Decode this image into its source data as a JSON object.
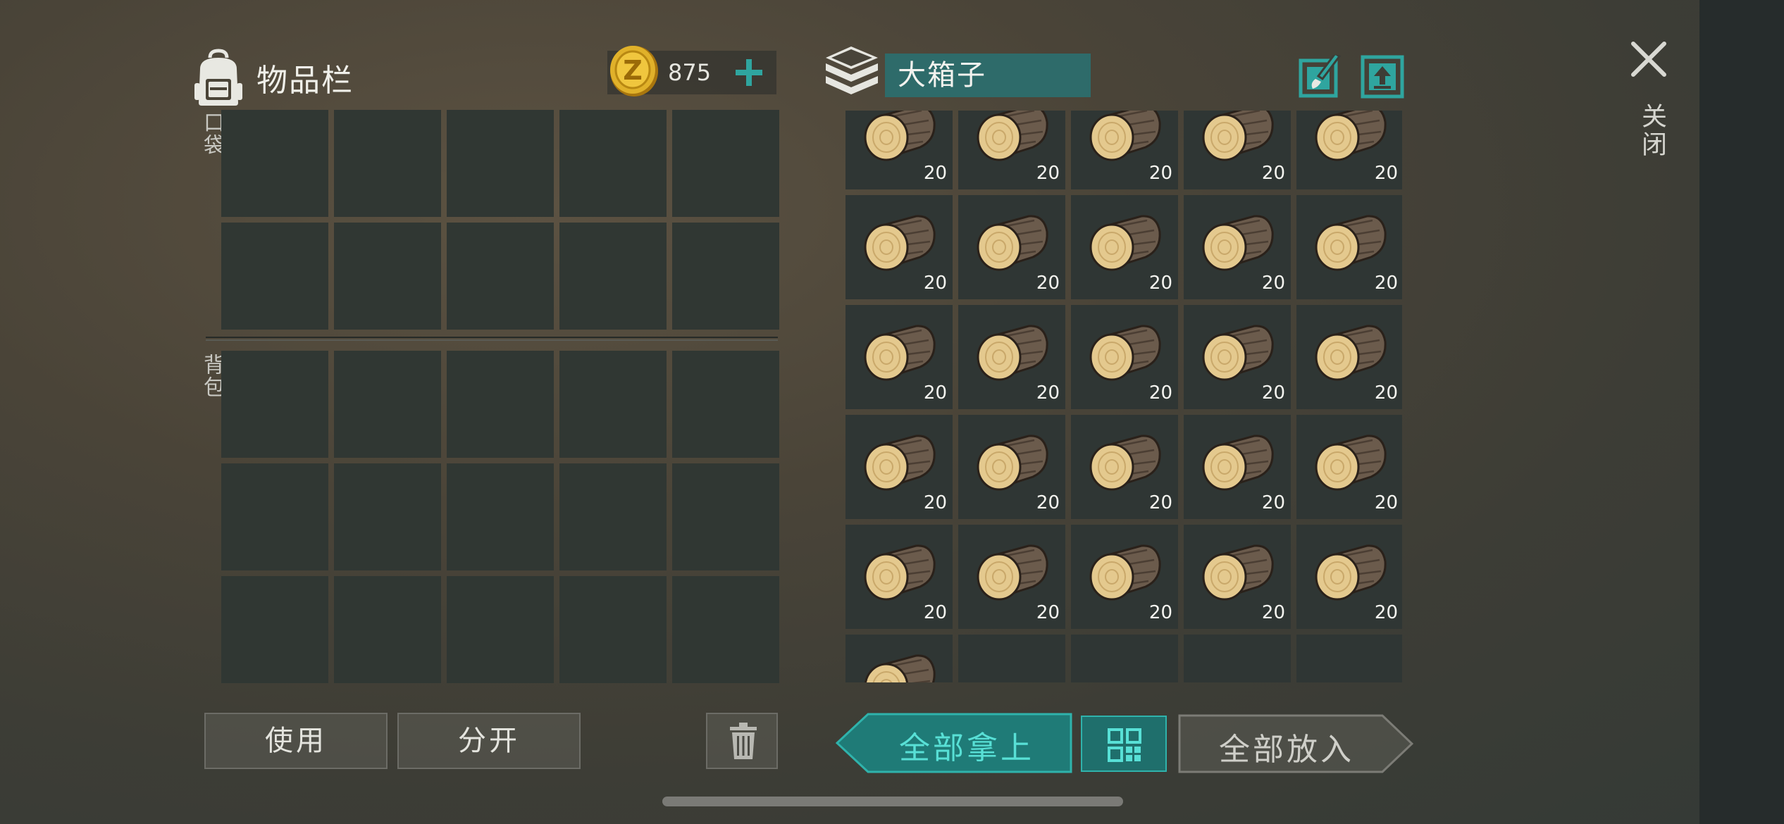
{
  "inventory": {
    "title": "物品栏",
    "coins": "875",
    "pocket_label": "口袋",
    "backpack_label": "背包",
    "pocket_slots": 10,
    "backpack_slots": 15
  },
  "storage": {
    "name": "大箱子",
    "item": "wood-log",
    "items": [
      "20",
      "20",
      "20",
      "20",
      "20",
      "20",
      "20",
      "20",
      "20",
      "20",
      "20",
      "20",
      "20",
      "20",
      "20",
      "20",
      "20",
      "20",
      "20",
      "20",
      "20",
      "20",
      "20",
      "20",
      "20",
      "",
      null,
      null,
      null,
      null
    ],
    "close_label": "关闭"
  },
  "buttons": {
    "use": "使用",
    "split": "分开",
    "take_all": "全部拿上",
    "put_all": "全部放入"
  },
  "colors": {
    "accent": "#2f9c98",
    "accent_dark": "#1f6f6c",
    "slot": "#303733",
    "coin": "#d9a91e"
  },
  "icons": [
    "backpack-icon",
    "coin-icon",
    "plus-icon",
    "storage-box-icon",
    "edit-brush-icon",
    "upload-icon",
    "close-icon",
    "trash-icon",
    "grid-sort-icon",
    "wood-log-icon"
  ]
}
